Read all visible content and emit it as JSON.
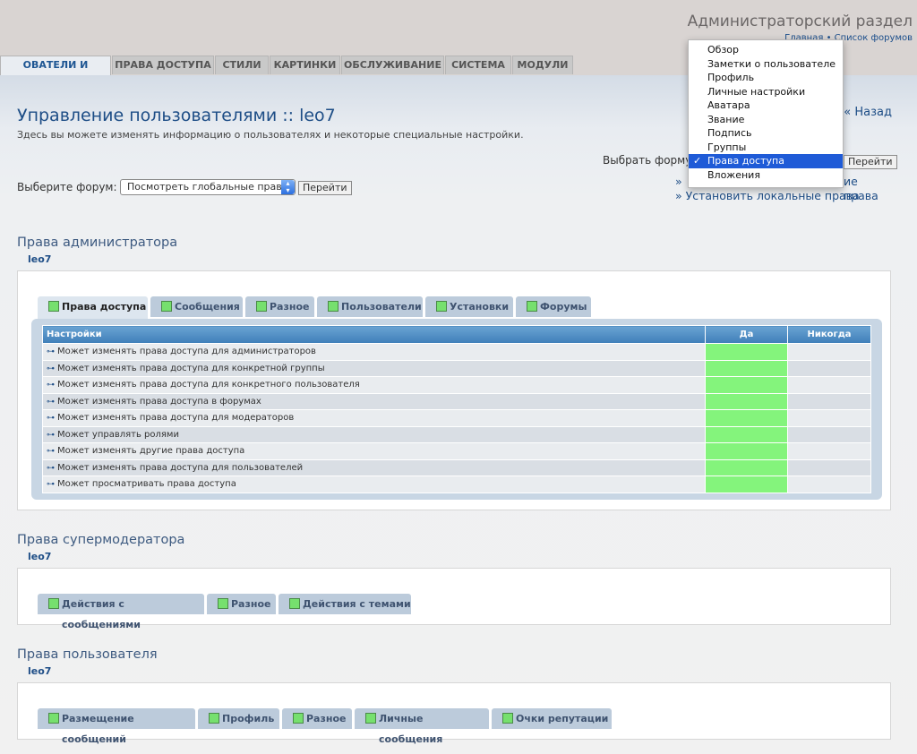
{
  "header": {
    "admin_title": "Администраторский раздел",
    "home_link": "Главная",
    "separator": "•",
    "forum_list_link": "Список форумов"
  },
  "top_tabs": [
    {
      "label": "ОВАТЕЛИ И ГРУППЫ",
      "active": true
    },
    {
      "label": "ПРАВА ДОСТУПА"
    },
    {
      "label": "СТИЛИ"
    },
    {
      "label": "КАРТИНКИ"
    },
    {
      "label": "ОБСЛУЖИВАНИЕ"
    },
    {
      "label": "СИСТЕМА"
    },
    {
      "label": "МОДУЛИ"
    }
  ],
  "page": {
    "title": "Управление пользователями :: leo7",
    "description": "Здесь вы можете изменять информацию о пользователях и некоторые специальные настройки.",
    "back_link": "« Назад",
    "choose_forum_label": "Выберите форум:",
    "forum_select_value": "Посмотреть глобальные права",
    "go_button": "Перейти",
    "select_form_label": "Выбрать форму:",
    "side_link_1": "» Установить глобальные права",
    "side_link_1_visible_tail": "ие права",
    "side_link_2": "» Установить локальные права"
  },
  "dropdown": {
    "items": [
      "Обзор",
      "Заметки о пользователе",
      "Профиль",
      "Личные настройки",
      "Аватара",
      "Звание",
      "Подпись",
      "Группы",
      "Права доступа",
      "Вложения"
    ],
    "selected_index": 8,
    "check": "✓",
    "go_button": "Перейти"
  },
  "admin_section": {
    "title": "Права администратора",
    "user": "leo7",
    "tabs": [
      "Права доступа",
      "Сообщения",
      "Разное",
      "Пользователи",
      "Установки",
      "Форумы"
    ],
    "table": {
      "headers": [
        "Настройки",
        "Да",
        "Никогда"
      ],
      "rows": [
        "Может изменять права доступа для администраторов",
        "Может изменять права доступа для конкретной группы",
        "Может изменять права доступа для конкретного пользователя",
        "Может изменять права доступа в форумах",
        "Может изменять права доступа для модераторов",
        "Может управлять ролями",
        "Может изменять другие права доступа",
        "Может изменять права доступа для пользователей",
        "Может просматривать права доступа"
      ]
    }
  },
  "supermod_section": {
    "title": "Права супермодератора",
    "user": "leo7",
    "tabs": [
      "Действия с сообщениями",
      "Разное",
      "Действия с темами"
    ]
  },
  "user_section": {
    "title": "Права пользователя",
    "user": "leo7",
    "tabs": [
      "Размещение сообщений",
      "Профиль",
      "Разное",
      "Личные сообщения",
      "Очки репутации"
    ]
  },
  "colors": {
    "accent": "#1d4d86",
    "yes_green": "#84f47c",
    "table_header": "#4a88c0",
    "dropdown_selected": "#1f5bd7"
  }
}
